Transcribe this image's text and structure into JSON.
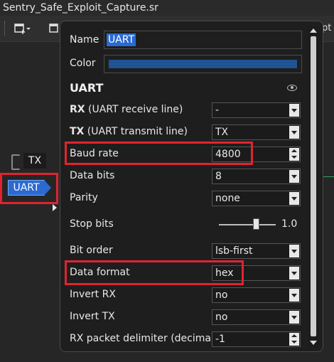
{
  "window": {
    "title": "Sentry_Safe_Exploit_Capture.sr"
  },
  "toolbar": {
    "right_text": "pt"
  },
  "canvas": {
    "tx_label": "TX",
    "uart_label": "UART"
  },
  "popup": {
    "name_label": "Name",
    "name_value": "UART",
    "color_label": "Color",
    "color_value": "#1f5393",
    "section_title": "UART",
    "rows": {
      "rx": {
        "label_bold": "RX",
        "label_rest": " (UART receive line)",
        "value": "-"
      },
      "tx": {
        "label_bold": "TX",
        "label_rest": " (UART transmit line)",
        "value": "TX"
      },
      "baud_rate": {
        "label": "Baud rate",
        "value": "4800"
      },
      "data_bits": {
        "label": "Data bits",
        "value": "8"
      },
      "parity": {
        "label": "Parity",
        "value": "none"
      },
      "stop_bits": {
        "label": "Stop bits",
        "value": "1.0"
      },
      "bit_order": {
        "label": "Bit order",
        "value": "lsb-first"
      },
      "data_format": {
        "label": "Data format",
        "value": "hex"
      },
      "invert_rx": {
        "label": "Invert RX",
        "value": "no"
      },
      "invert_tx": {
        "label": "Invert TX",
        "value": "no"
      },
      "rx_delim": {
        "label": "RX packet delimiter (decimal)",
        "value": "-1"
      }
    }
  },
  "colors": {
    "highlight": "#e0242f",
    "accent": "#2a6ad1"
  }
}
